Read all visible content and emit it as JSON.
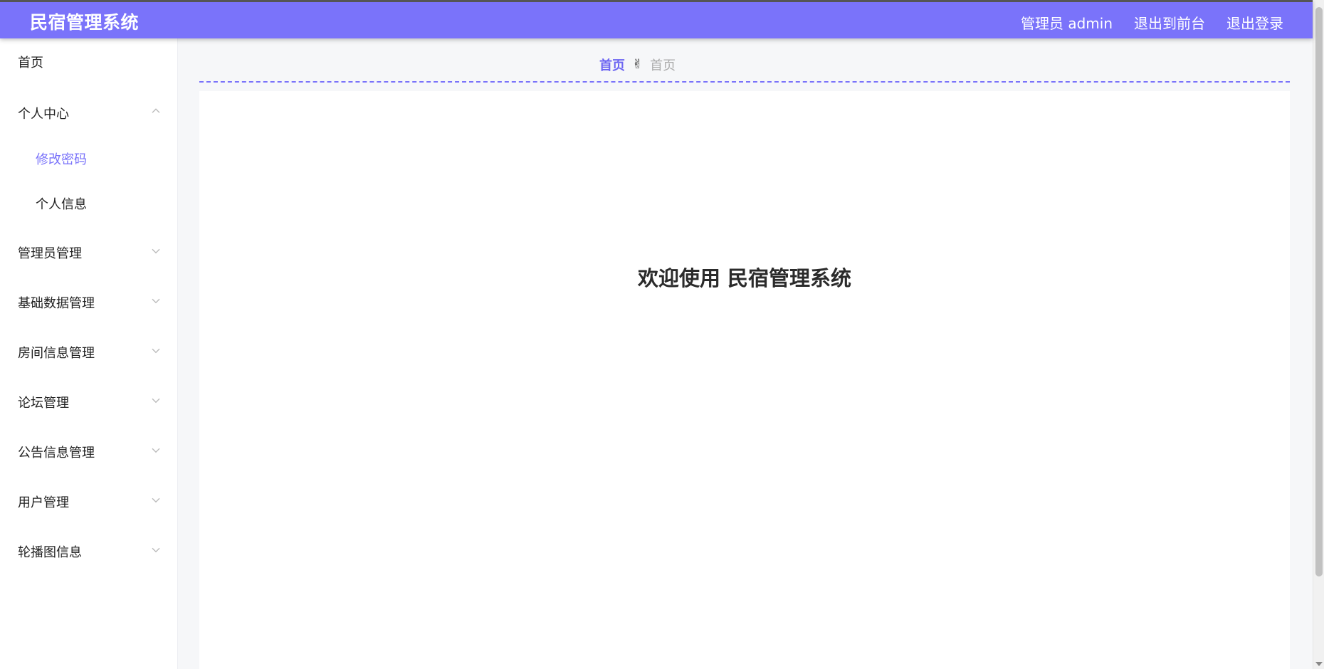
{
  "header": {
    "title": "民宿管理系统",
    "admin_label": "管理员 admin",
    "exit_front_label": "退出到前台",
    "logout_label": "退出登录"
  },
  "sidebar": {
    "items": [
      {
        "label": "首页",
        "expandable": false
      },
      {
        "label": "个人中心",
        "expandable": true,
        "expanded": true
      },
      {
        "label": "管理员管理",
        "expandable": true
      },
      {
        "label": "基础数据管理",
        "expandable": true
      },
      {
        "label": "房间信息管理",
        "expandable": true
      },
      {
        "label": "论坛管理",
        "expandable": true
      },
      {
        "label": "公告信息管理",
        "expandable": true
      },
      {
        "label": "用户管理",
        "expandable": true
      },
      {
        "label": "轮播图信息",
        "expandable": true
      }
    ],
    "subitems": [
      {
        "label": "修改密码",
        "active": true
      },
      {
        "label": "个人信息",
        "active": false
      }
    ]
  },
  "breadcrumb": {
    "home": "首页",
    "separator": "✌",
    "current": "首页"
  },
  "main": {
    "welcome": "欢迎使用 民宿管理系统"
  },
  "colors": {
    "accent": "#7a73fa",
    "breadcrumb_home": "#6d66f2",
    "muted": "#aaaaaa"
  }
}
